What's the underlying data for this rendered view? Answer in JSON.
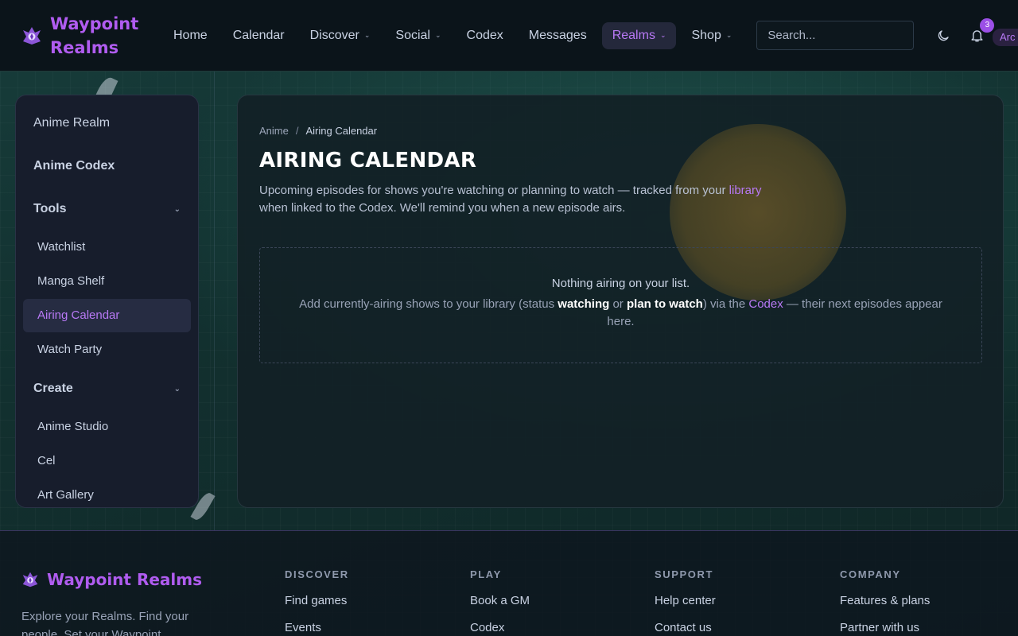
{
  "brand": {
    "name": "Waypoint Realms",
    "accent": "#b05cf0"
  },
  "nav": {
    "items": [
      {
        "label": "Home",
        "dropdown": false
      },
      {
        "label": "Calendar",
        "dropdown": false
      },
      {
        "label": "Discover",
        "dropdown": true
      },
      {
        "label": "Social",
        "dropdown": true
      },
      {
        "label": "Codex",
        "dropdown": false
      },
      {
        "label": "Messages",
        "dropdown": false
      },
      {
        "label": "Realms",
        "dropdown": true,
        "active": true
      },
      {
        "label": "Shop",
        "dropdown": true
      }
    ],
    "search_placeholder": "Search...",
    "notifications_count": "3",
    "user_chip": "Arc"
  },
  "sidebar": {
    "top_links": [
      "Anime Realm",
      "Anime Codex"
    ],
    "sections": [
      {
        "title": "Tools",
        "items": [
          "Watchlist",
          "Manga Shelf",
          "Airing Calendar",
          "Watch Party"
        ],
        "active": "Airing Calendar"
      },
      {
        "title": "Create",
        "items": [
          "Anime Studio",
          "Cel",
          "Art Gallery"
        ]
      }
    ]
  },
  "main": {
    "breadcrumb": {
      "parent": "Anime",
      "separator": "/",
      "current": "Airing Calendar"
    },
    "title": "AIRING CALENDAR",
    "description_before_link": "Upcoming episodes for shows you're watching or planning to watch — tracked from your ",
    "description_link": "library",
    "description_after_link": " when linked to the Codex. We'll remind you when a new episode airs.",
    "empty_state": {
      "title": "Nothing airing on your list.",
      "body_part1": "Add currently-airing shows to your library (status ",
      "status_watching": "watching",
      "body_or": " or ",
      "status_plan": "plan to watch",
      "body_part2": ") via the ",
      "codex_link": "Codex",
      "body_part3": " — their next episodes appear here."
    }
  },
  "footer": {
    "brand": "Waypoint Realms",
    "tagline": "Explore your Realms. Find your people. Set your Waypoint.",
    "columns": [
      {
        "title": "DISCOVER",
        "links": [
          "Find games",
          "Events"
        ]
      },
      {
        "title": "PLAY",
        "links": [
          "Book a GM",
          "Codex"
        ]
      },
      {
        "title": "SUPPORT",
        "links": [
          "Help center",
          "Contact us"
        ]
      },
      {
        "title": "COMPANY",
        "links": [
          "Features & plans",
          "Partner with us"
        ]
      }
    ]
  },
  "colors": {
    "link": "#b879f5",
    "badge": "#9b4fe6",
    "panel": "#171d2c"
  }
}
